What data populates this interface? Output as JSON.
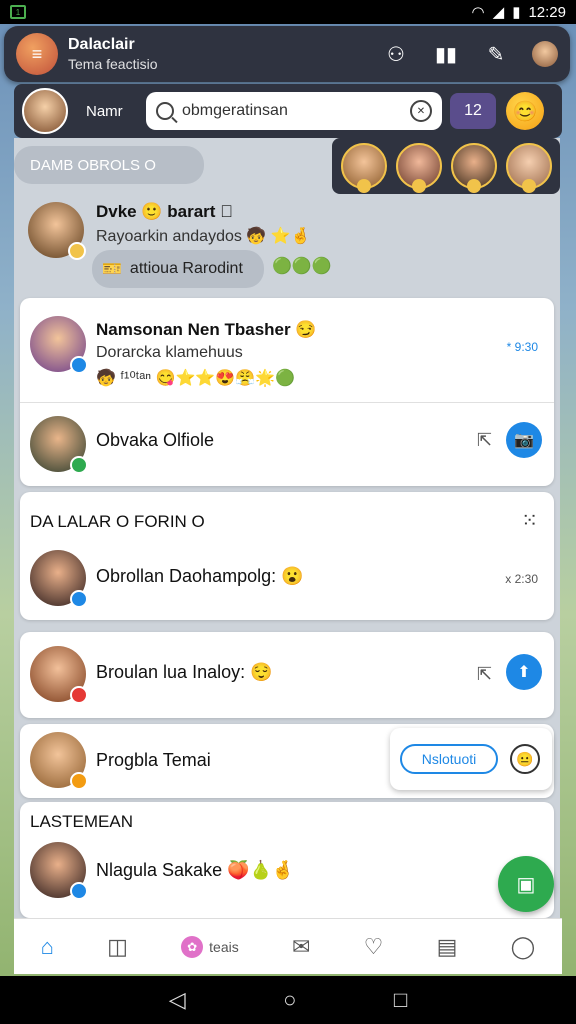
{
  "status_bar": {
    "time": "12:29",
    "sim_icon": "sim-icon",
    "wifi_icon": "wifi-icon",
    "signal_icon": "signal-icon",
    "battery_icon": "battery-icon"
  },
  "header": {
    "title": "Dalaclair",
    "subtitle": "Tema feactisio",
    "icons": [
      "people-icon",
      "stats-icon",
      "compose-icon",
      "profile-icon"
    ]
  },
  "subheader": {
    "me_label": "Namr",
    "search_value": "obmgeratinsan",
    "count_badge": "12",
    "emoji": "😊"
  },
  "section_pill": "DAMB OBROLS O",
  "first_chat": {
    "name": "Dvke 🙂 barart 🏻",
    "message": "Rayoarkin andaydos 🧒 ⭐🤞",
    "reply_label": "attioua Rarodint",
    "reply_emojis": "🟢🟢🟢"
  },
  "chats_card1": [
    {
      "name": "Namsonan Nen Tbasher 😏",
      "message": "Dorarcka klamehuus",
      "reactions": "🧒 ᶠ¹⁰ᵗᵃⁿ 😋⭐⭐😍😤🌟🟢",
      "time": "* 9:30"
    },
    {
      "name": "Obvaka Olfiole",
      "pin_icon": "pin-icon"
    }
  ],
  "section2": {
    "title": "DA LALAR O FORIN O",
    "chat_name": "Obrollan Daohampolg: 😮",
    "time": "x 2:30"
  },
  "chat_broulan": {
    "name": "Broulan lua Inaloy: 😌"
  },
  "chat_progbla": {
    "name": "Progbla Temai"
  },
  "action_chip": {
    "label": "Nslotuoti",
    "smile": "😐"
  },
  "section3": {
    "title": "LASTEMEAN",
    "chat_name": "Nlagula Sakake 🍑🍐🤞"
  },
  "bottom_nav": {
    "center_label": "teais"
  }
}
